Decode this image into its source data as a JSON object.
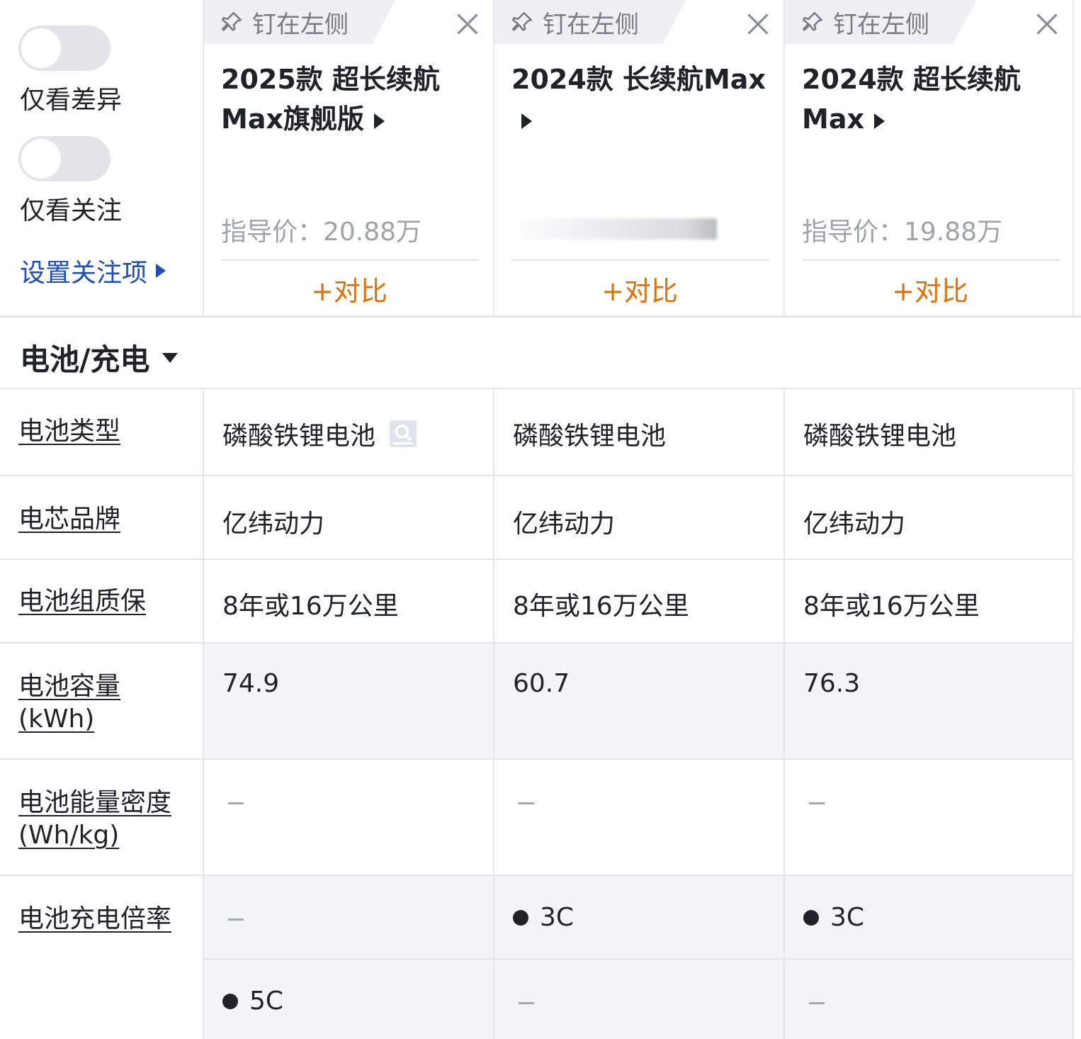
{
  "filters": {
    "diff_only_label": "仅看差异",
    "focus_only_label": "仅看关注",
    "set_focus_label": "设置关注项"
  },
  "cars": [
    {
      "pin_label": "钉在左侧",
      "title": "2025款 超长续航Max旗舰版",
      "price": "指导价：20.88万",
      "compare_label": "+对比"
    },
    {
      "pin_label": "钉在左侧",
      "title": "2024款 长续航Max",
      "price": "",
      "compare_label": "+对比"
    },
    {
      "pin_label": "钉在左侧",
      "title": "2024款 超长续航Max",
      "price": "指导价：19.88万",
      "compare_label": "+对比"
    }
  ],
  "section": {
    "title": "电池/充电"
  },
  "rows": [
    {
      "label": "电池类型",
      "values": [
        "磷酸铁锂电池",
        "磷酸铁锂电池",
        "磷酸铁锂电池"
      ]
    },
    {
      "label": "电芯品牌",
      "values": [
        "亿纬动力",
        "亿纬动力",
        "亿纬动力"
      ]
    },
    {
      "label": "电池组质保",
      "values": [
        "8年或16万公里",
        "8年或16万公里",
        "8年或16万公里"
      ]
    },
    {
      "label": "电池容量(kWh)",
      "values": [
        "74.9",
        "60.7",
        "76.3"
      ]
    },
    {
      "label": "电池能量密度(Wh/kg)",
      "values": [
        "–",
        "–",
        "–"
      ]
    },
    {
      "label": "电池充电倍率",
      "values": [
        "–",
        "3C",
        "3C"
      ],
      "values2": [
        "5C",
        "–",
        "–"
      ]
    }
  ],
  "colors": {
    "accent_orange": "#d9730d",
    "link_blue": "#1e4fb3",
    "shade": "#f3f4f8"
  }
}
